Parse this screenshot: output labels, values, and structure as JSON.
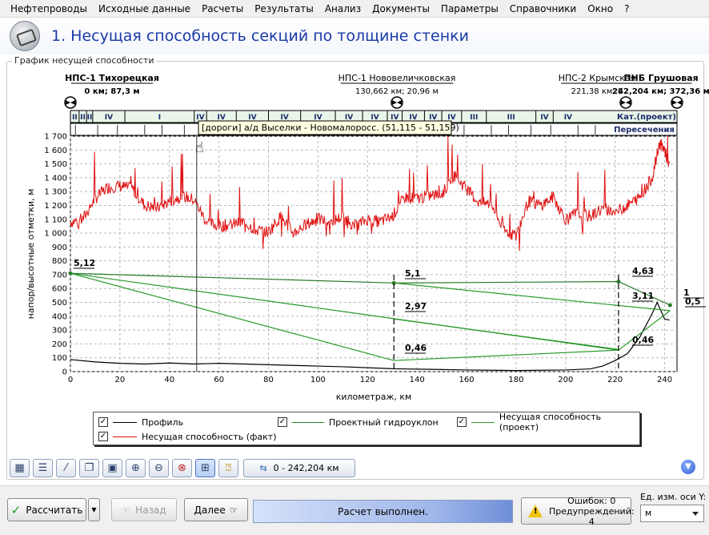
{
  "menu": [
    "Нефтепроводы",
    "Исходные данные",
    "Расчеты",
    "Результаты",
    "Анализ",
    "Документы",
    "Параметры",
    "Справочники",
    "Окно",
    "?"
  ],
  "page_title": "1. Несущая способность секций по толщине стенки",
  "group_title": "График несущей способности",
  "stations": [
    {
      "name": "НПС-1 Тихорецкая",
      "info": "0 км; 87,3 м",
      "km": 0,
      "bold": true
    },
    {
      "name": "НПС-1 Нововеличковская",
      "info": "130,662 км; 20,96 м",
      "km": 130.662,
      "bold": false
    },
    {
      "name": "НПС-2 Крымская",
      "info": "221,38 км; 9",
      "km": 221.38,
      "bold": false
    },
    {
      "name": "ПНБ Грушовая",
      "info": "242,204 км; 372,36 м",
      "km": 242.204,
      "bold": true
    }
  ],
  "categories": [
    "II",
    "II",
    "II",
    "IV",
    "I",
    "IV",
    "IV",
    "IV",
    "IV",
    "IV",
    "IV",
    "IV",
    "IV",
    "IV",
    "IV",
    "IV",
    "III",
    "III",
    "IV",
    "IV"
  ],
  "category_row_label": "Кат.(проект)",
  "crossings_row_label": "Пересечения",
  "tooltip": "[дороги] а/д Выселки - Новомалоросс. (51,115 - 51,159)",
  "yaxis_label": "напор/высотные отметки, м",
  "xaxis_label": "километраж, км",
  "annotations": [
    "5,12",
    "5,1",
    "2,97",
    "0,46",
    "4,63",
    "3,11",
    "0,46",
    "1",
    "0,5"
  ],
  "chart_data": {
    "type": "line",
    "xlabel": "километраж, км",
    "ylabel": "напор/высотные отметки, м",
    "xlim": [
      0,
      245
    ],
    "ylim": [
      0,
      1700
    ],
    "x_ticks": [
      0,
      20,
      40,
      60,
      80,
      100,
      120,
      140,
      160,
      180,
      200,
      220,
      240
    ],
    "y_ticks": [
      0,
      100,
      200,
      300,
      400,
      500,
      600,
      700,
      800,
      900,
      1000,
      1100,
      1200,
      1300,
      1400,
      1500,
      1600,
      1700
    ],
    "y_tick_labels": [
      "0",
      "100",
      "200",
      "300",
      "400",
      "500",
      "600",
      "700",
      "800",
      "900",
      "1 000",
      "1 100",
      "1 200",
      "1 300",
      "1 400",
      "1 500",
      "1 600",
      "1 700"
    ],
    "series": [
      {
        "name": "Профиль",
        "color": "#000000",
        "x": [
          0,
          10,
          20,
          30,
          40,
          50,
          60,
          70,
          80,
          90,
          100,
          110,
          120,
          130,
          140,
          150,
          160,
          170,
          180,
          190,
          200,
          210,
          215,
          220,
          225,
          230,
          235,
          237,
          240,
          242
        ],
        "y": [
          87,
          70,
          60,
          55,
          62,
          55,
          60,
          55,
          50,
          45,
          40,
          35,
          28,
          21,
          18,
          15,
          12,
          10,
          8,
          10,
          12,
          20,
          40,
          80,
          130,
          250,
          420,
          500,
          380,
          372
        ]
      },
      {
        "name": "Несущая способность (факт)",
        "color": "#e01010",
        "x": [
          0,
          5,
          10,
          15,
          20,
          25,
          30,
          35,
          40,
          45,
          50,
          55,
          60,
          65,
          70,
          75,
          80,
          85,
          90,
          95,
          100,
          105,
          110,
          115,
          120,
          125,
          130,
          135,
          140,
          145,
          150,
          155,
          160,
          165,
          170,
          175,
          180,
          185,
          190,
          195,
          200,
          205,
          210,
          215,
          220,
          225,
          230,
          235,
          238,
          240,
          242
        ],
        "y": [
          1080,
          1100,
          1250,
          1330,
          1340,
          1320,
          1200,
          1180,
          1230,
          1270,
          1240,
          1080,
          1050,
          1060,
          1080,
          1020,
          1010,
          1120,
          1000,
          1060,
          1100,
          1080,
          1120,
          1050,
          1100,
          1080,
          1120,
          1260,
          1250,
          1270,
          1280,
          1420,
          1320,
          1220,
          1210,
          1020,
          980,
          1230,
          1200,
          1260,
          1100,
          1150,
          1120,
          1180,
          1150,
          1200,
          1260,
          1400,
          1650,
          1600,
          1480
        ]
      },
      {
        "name": "Проектный гидроуклон",
        "color": "#2a7a2a",
        "x": [
          0,
          130.662,
          221.38,
          242.204
        ],
        "y": [
          710,
          640,
          650,
          480
        ]
      },
      {
        "name": "Несущая способность (проект)",
        "color": "#2a9a2a",
        "x": [
          0,
          130.662,
          221.38,
          242.204
        ],
        "y": [
          710,
          80,
          155,
          440
        ]
      }
    ],
    "legend": "bottom"
  },
  "legend": {
    "profile": "Профиль",
    "hydro": "Проектный гидроуклон",
    "cap_project": "Несущая способность (проект)",
    "cap_fact": "Несущая способность (факт)",
    "check": "✓"
  },
  "toolbar": {
    "range": "0 - 242,204 км"
  },
  "buttons": {
    "calc": "Рассчитать",
    "back": "Назад",
    "next": "Далее"
  },
  "status": "Расчет выполнен.",
  "errors": "Ошибок: 0",
  "warnings": "Предупреждений: 4",
  "unit_label": "Ед. изм. оси Y:",
  "unit_value": "м"
}
